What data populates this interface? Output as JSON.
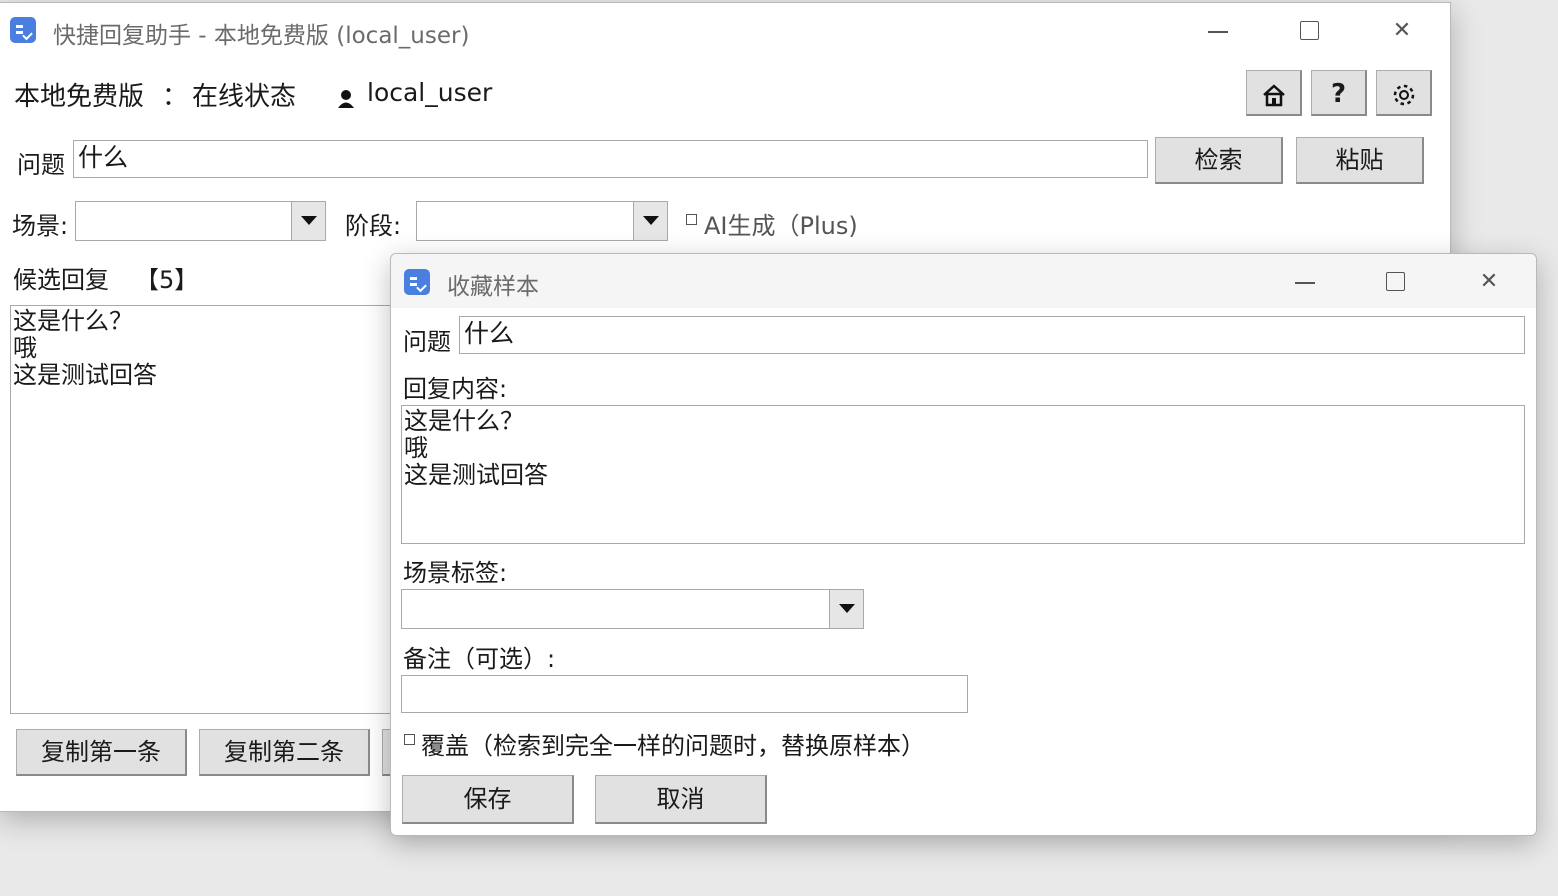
{
  "main_window": {
    "title": "快捷回复助手 - 本地免费版 (local_user)",
    "status_left": "本地免费版",
    "status_sep": "：",
    "status_right": "在线状态",
    "username": "local_user",
    "help_glyph": "?",
    "question_label": "问题",
    "question_value": "什么",
    "search_button": "检索",
    "paste_button": "粘贴",
    "scene_label": "场景:",
    "stage_label": "阶段:",
    "ai_checkbox_label": "AI生成（Plus)",
    "candidates_label": "候选回复",
    "candidates_count": "【5】",
    "candidate_lines": [
      "这是什么？",
      "哦",
      "这是测试回答"
    ],
    "copy_first_button": "复制第一条",
    "copy_second_button": "复制第二条"
  },
  "dialog": {
    "title": "收藏样本",
    "question_label": "问题",
    "question_value": "什么",
    "reply_label": "回复内容:",
    "reply_lines": [
      "这是什么？",
      "哦",
      "这是测试回答"
    ],
    "scene_tag_label": "场景标签:",
    "note_label": "备注（可选）:",
    "overwrite_label": "覆盖（检索到完全一样的问题时，替换原样本）",
    "save_button": "保存",
    "cancel_button": "取消"
  },
  "icons": {
    "minimize": "minimize-icon",
    "maximize": "maximize-icon",
    "close": "close-icon",
    "home": "home-icon",
    "help": "help-icon",
    "settings": "gear-icon",
    "user": "user-icon",
    "app": "app-icon"
  },
  "colors": {
    "app_icon": "#4a7fe0",
    "button_face": "#e1e1e1",
    "window_bg": "#ffffff"
  }
}
